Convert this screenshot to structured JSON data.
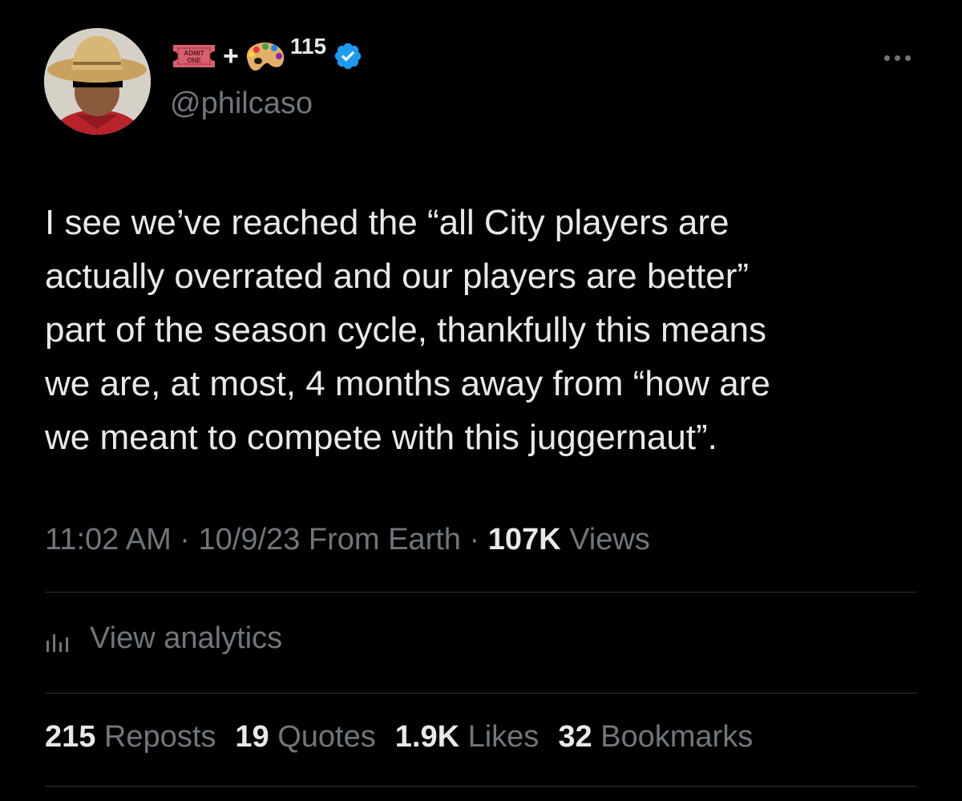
{
  "author": {
    "display_name_number": "115",
    "display_name_plus": "+",
    "ticket_text_line1": "ADMIT",
    "ticket_text_line2": "ONE",
    "handle": "@philcaso",
    "verified": true
  },
  "tweet": {
    "text": "I see we’ve reached the “all City players are\nactually overrated and our players are better”\npart of the season cycle, thankfully this means\nwe are, at most, 4 months away from “how are\nwe meant to compete with this juggernaut”."
  },
  "meta": {
    "time": "11:02 AM",
    "separator": "·",
    "date": "10/9/23",
    "location": "From Earth",
    "views_count": "107K",
    "views_label": "Views"
  },
  "analytics": {
    "label": "View analytics"
  },
  "stats": [
    {
      "count": "215",
      "label": "Reposts"
    },
    {
      "count": "19",
      "label": "Quotes"
    },
    {
      "count": "1.9K",
      "label": "Likes"
    },
    {
      "count": "32",
      "label": "Bookmarks"
    }
  ],
  "icons": {
    "more": "more-horizontal-icon",
    "verified": "verified-badge-icon",
    "analytics": "bar-chart-icon",
    "ticket": "admission-ticket-emoji",
    "palette": "artist-palette-emoji"
  },
  "colors": {
    "background": "#000000",
    "primary_text": "#e7e9ea",
    "secondary_text": "#71767b",
    "verified_blue": "#1d9bf0",
    "divider": "#2f3336"
  }
}
